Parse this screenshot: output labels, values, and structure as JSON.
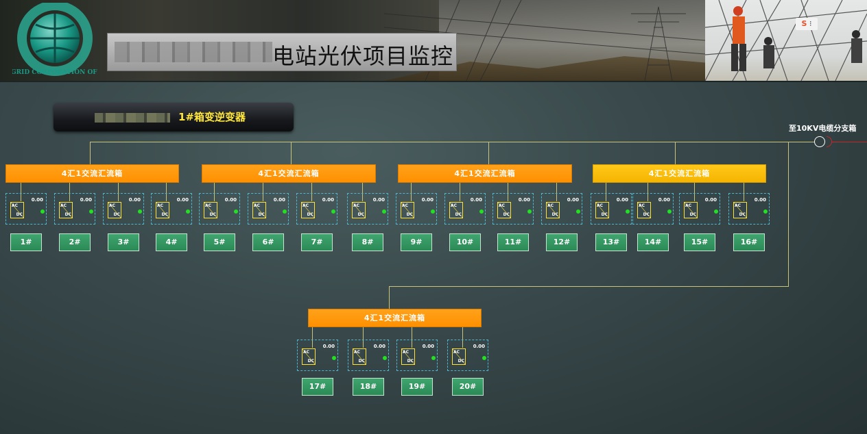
{
  "header": {
    "title": "电站光伏项目监控",
    "logo_text": "STATE GRID CORPORATION OF CHINA",
    "sohu_icon": "S"
  },
  "section": {
    "label": "1#箱变逆变器",
    "feeder_label": "至10KV电缆分支箱"
  },
  "colors": {
    "combiner": "#ff9800",
    "combiner_highlight": "#f5b400",
    "button": "#2f8f5a",
    "status_on": "#22e022",
    "bus_line": "#c8c47a",
    "inverter_border": "#4fb7cf"
  },
  "combiner_label": "4汇1交流汇流箱",
  "combiners": [
    {
      "label": "4汇1交流汇流箱",
      "highlight": false
    },
    {
      "label": "4汇1交流汇流箱",
      "highlight": false
    },
    {
      "label": "4汇1交流汇流箱",
      "highlight": false
    },
    {
      "label": "4汇1交流汇流箱",
      "highlight": true
    },
    {
      "label": "4汇1交流汇流箱",
      "highlight": false
    }
  ],
  "inverter_symbol": {
    "ac": "AC",
    "dc": "DC"
  },
  "inverters": [
    {
      "id": "1#",
      "value": "0.00",
      "status": "online"
    },
    {
      "id": "2#",
      "value": "0.00",
      "status": "online"
    },
    {
      "id": "3#",
      "value": "0.00",
      "status": "online"
    },
    {
      "id": "4#",
      "value": "0.00",
      "status": "online"
    },
    {
      "id": "5#",
      "value": "0.00",
      "status": "online"
    },
    {
      "id": "6#",
      "value": "0.00",
      "status": "online"
    },
    {
      "id": "7#",
      "value": "0.00",
      "status": "online"
    },
    {
      "id": "8#",
      "value": "0.00",
      "status": "online"
    },
    {
      "id": "9#",
      "value": "0.00",
      "status": "online"
    },
    {
      "id": "10#",
      "value": "0.00",
      "status": "online"
    },
    {
      "id": "11#",
      "value": "0.00",
      "status": "online"
    },
    {
      "id": "12#",
      "value": "0.00",
      "status": "online"
    },
    {
      "id": "13#",
      "value": "0.00",
      "status": "online"
    },
    {
      "id": "14#",
      "value": "0.00",
      "status": "online"
    },
    {
      "id": "15#",
      "value": "0.00",
      "status": "online"
    },
    {
      "id": "16#",
      "value": "0.00",
      "status": "online"
    },
    {
      "id": "17#",
      "value": "0.00",
      "status": "online"
    },
    {
      "id": "18#",
      "value": "0.00",
      "status": "online"
    },
    {
      "id": "19#",
      "value": "0.00",
      "status": "online"
    },
    {
      "id": "20#",
      "value": "0.00",
      "status": "online"
    }
  ]
}
